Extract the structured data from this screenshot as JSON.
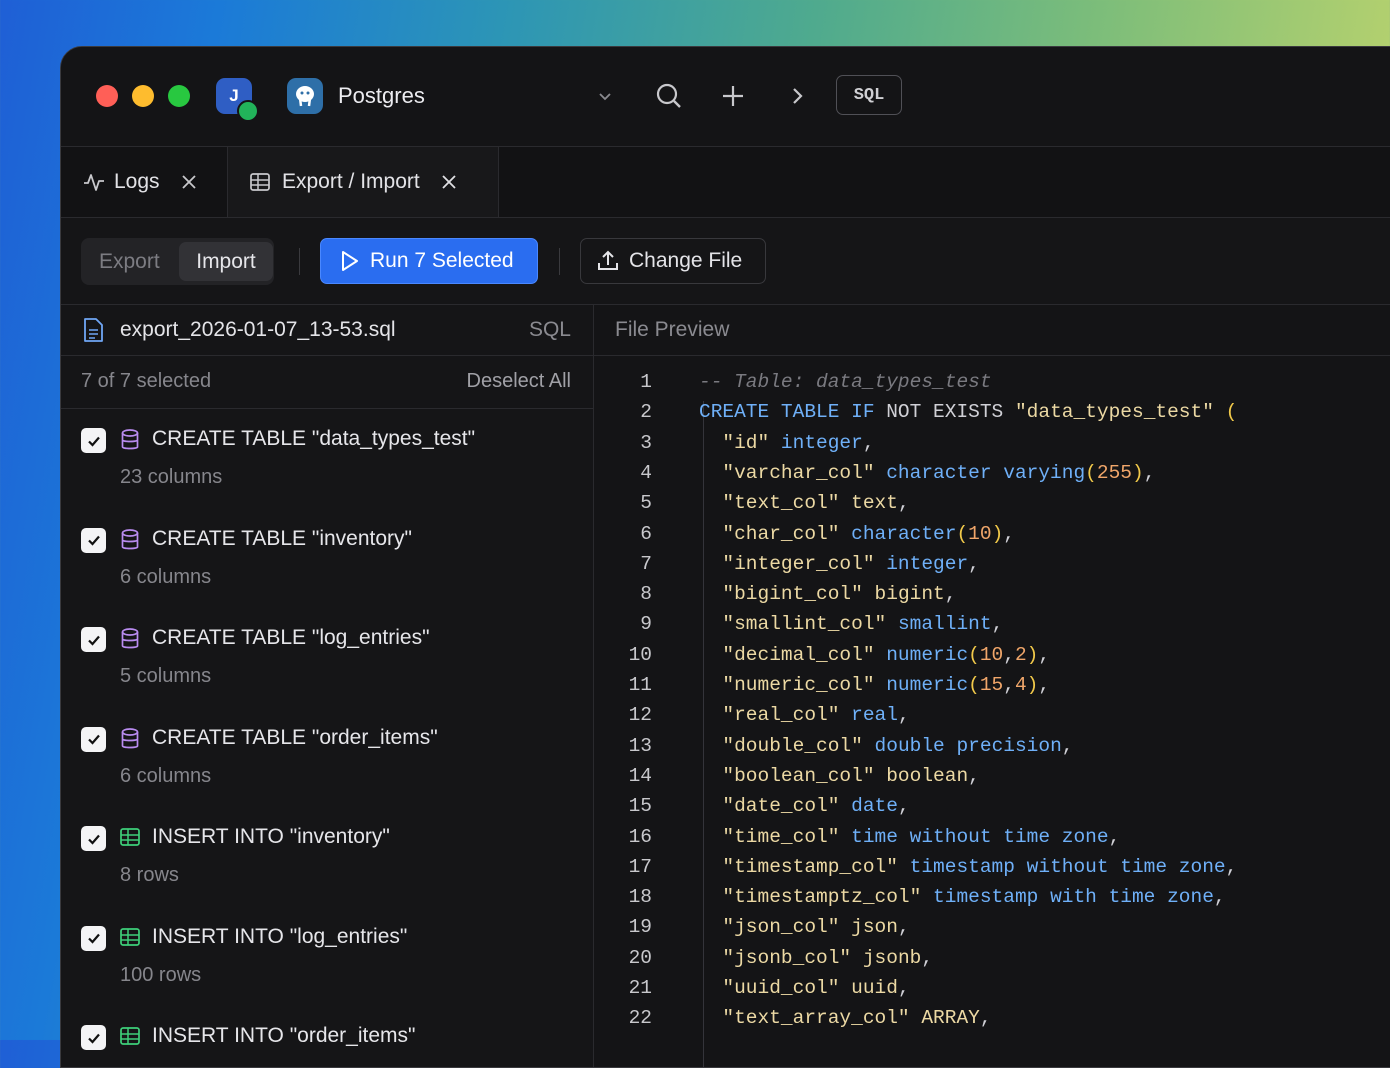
{
  "titlebar": {
    "avatar_initial": "J",
    "db_name": "Postgres",
    "sql_button": "SQL",
    "colors": {
      "close": "#ff5f57",
      "minimize": "#febc2e",
      "zoom": "#28c840"
    }
  },
  "tabs": [
    {
      "label": "Logs",
      "icon": "activity-icon"
    },
    {
      "label": "Export / Import",
      "icon": "table-icon"
    }
  ],
  "toolbar": {
    "mode_export": "Export",
    "mode_import": "Import",
    "run_label": "Run 7 Selected",
    "change_file_label": "Change File"
  },
  "left": {
    "file_name": "export_2026-01-07_13-53.sql",
    "file_type": "SQL",
    "selected_count": "7 of 7 selected",
    "deselect_all": "Deselect All",
    "items": [
      {
        "title": "CREATE TABLE \"data_types_test\"",
        "sub": "23 columns",
        "kind": "table"
      },
      {
        "title": "CREATE TABLE \"inventory\"",
        "sub": "6 columns",
        "kind": "table"
      },
      {
        "title": "CREATE TABLE \"log_entries\"",
        "sub": "5 columns",
        "kind": "table"
      },
      {
        "title": "CREATE TABLE \"order_items\"",
        "sub": "6 columns",
        "kind": "table"
      },
      {
        "title": "INSERT INTO \"inventory\"",
        "sub": "8 rows",
        "kind": "insert"
      },
      {
        "title": "INSERT INTO \"log_entries\"",
        "sub": "100 rows",
        "kind": "insert"
      },
      {
        "title": "INSERT INTO \"order_items\"",
        "sub": "",
        "kind": "insert"
      }
    ]
  },
  "preview": {
    "title": "File Preview",
    "lines": [
      [
        [
          "cm",
          "-- Table: data_types_test"
        ]
      ],
      [
        [
          "kw",
          "CREATE TABLE IF "
        ],
        [
          "pl",
          "NOT EXISTS "
        ],
        [
          "str",
          "\"data_types_test\""
        ],
        [
          "pl",
          " "
        ],
        [
          "pn",
          "("
        ]
      ],
      [
        [
          "pl",
          "  "
        ],
        [
          "str",
          "\"id\""
        ],
        [
          "pl",
          " "
        ],
        [
          "ty",
          "integer"
        ],
        [
          "pl",
          ","
        ]
      ],
      [
        [
          "pl",
          "  "
        ],
        [
          "str",
          "\"varchar_col\""
        ],
        [
          "pl",
          " "
        ],
        [
          "ty",
          "character varying"
        ],
        [
          "pn",
          "("
        ],
        [
          "num",
          "255"
        ],
        [
          "pn",
          ")"
        ],
        [
          "pl",
          ","
        ]
      ],
      [
        [
          "pl",
          "  "
        ],
        [
          "str",
          "\"text_col\""
        ],
        [
          "pl",
          " "
        ],
        [
          "str",
          "text"
        ],
        [
          "pl",
          ","
        ]
      ],
      [
        [
          "pl",
          "  "
        ],
        [
          "str",
          "\"char_col\""
        ],
        [
          "pl",
          " "
        ],
        [
          "ty",
          "character"
        ],
        [
          "pn",
          "("
        ],
        [
          "num",
          "10"
        ],
        [
          "pn",
          ")"
        ],
        [
          "pl",
          ","
        ]
      ],
      [
        [
          "pl",
          "  "
        ],
        [
          "str",
          "\"integer_col\""
        ],
        [
          "pl",
          " "
        ],
        [
          "ty",
          "integer"
        ],
        [
          "pl",
          ","
        ]
      ],
      [
        [
          "pl",
          "  "
        ],
        [
          "str",
          "\"bigint_col\""
        ],
        [
          "pl",
          " "
        ],
        [
          "str",
          "bigint"
        ],
        [
          "pl",
          ","
        ]
      ],
      [
        [
          "pl",
          "  "
        ],
        [
          "str",
          "\"smallint_col\""
        ],
        [
          "pl",
          " "
        ],
        [
          "ty",
          "smallint"
        ],
        [
          "pl",
          ","
        ]
      ],
      [
        [
          "pl",
          "  "
        ],
        [
          "str",
          "\"decimal_col\""
        ],
        [
          "pl",
          " "
        ],
        [
          "ty",
          "numeric"
        ],
        [
          "pn",
          "("
        ],
        [
          "num",
          "10"
        ],
        [
          "pl",
          ","
        ],
        [
          "num",
          "2"
        ],
        [
          "pn",
          ")"
        ],
        [
          "pl",
          ","
        ]
      ],
      [
        [
          "pl",
          "  "
        ],
        [
          "str",
          "\"numeric_col\""
        ],
        [
          "pl",
          " "
        ],
        [
          "ty",
          "numeric"
        ],
        [
          "pn",
          "("
        ],
        [
          "num",
          "15"
        ],
        [
          "pl",
          ","
        ],
        [
          "num",
          "4"
        ],
        [
          "pn",
          ")"
        ],
        [
          "pl",
          ","
        ]
      ],
      [
        [
          "pl",
          "  "
        ],
        [
          "str",
          "\"real_col\""
        ],
        [
          "pl",
          " "
        ],
        [
          "ty",
          "real"
        ],
        [
          "pl",
          ","
        ]
      ],
      [
        [
          "pl",
          "  "
        ],
        [
          "str",
          "\"double_col\""
        ],
        [
          "pl",
          " "
        ],
        [
          "ty",
          "double precision"
        ],
        [
          "pl",
          ","
        ]
      ],
      [
        [
          "pl",
          "  "
        ],
        [
          "str",
          "\"boolean_col\""
        ],
        [
          "pl",
          " "
        ],
        [
          "str",
          "boolean"
        ],
        [
          "pl",
          ","
        ]
      ],
      [
        [
          "pl",
          "  "
        ],
        [
          "str",
          "\"date_col\""
        ],
        [
          "pl",
          " "
        ],
        [
          "ty",
          "date"
        ],
        [
          "pl",
          ","
        ]
      ],
      [
        [
          "pl",
          "  "
        ],
        [
          "str",
          "\"time_col\""
        ],
        [
          "pl",
          " "
        ],
        [
          "ty",
          "time without time zone"
        ],
        [
          "pl",
          ","
        ]
      ],
      [
        [
          "pl",
          "  "
        ],
        [
          "str",
          "\"timestamp_col\""
        ],
        [
          "pl",
          " "
        ],
        [
          "ty",
          "timestamp without time zone"
        ],
        [
          "pl",
          ","
        ]
      ],
      [
        [
          "pl",
          "  "
        ],
        [
          "str",
          "\"timestamptz_col\""
        ],
        [
          "pl",
          " "
        ],
        [
          "ty",
          "timestamp with time zone"
        ],
        [
          "pl",
          ","
        ]
      ],
      [
        [
          "pl",
          "  "
        ],
        [
          "str",
          "\"json_col\""
        ],
        [
          "pl",
          " "
        ],
        [
          "str",
          "json"
        ],
        [
          "pl",
          ","
        ]
      ],
      [
        [
          "pl",
          "  "
        ],
        [
          "str",
          "\"jsonb_col\""
        ],
        [
          "pl",
          " "
        ],
        [
          "str",
          "jsonb"
        ],
        [
          "pl",
          ","
        ]
      ],
      [
        [
          "pl",
          "  "
        ],
        [
          "str",
          "\"uuid_col\""
        ],
        [
          "pl",
          " "
        ],
        [
          "str",
          "uuid"
        ],
        [
          "pl",
          ","
        ]
      ],
      [
        [
          "pl",
          "  "
        ],
        [
          "str",
          "\"text_array_col\""
        ],
        [
          "pl",
          " "
        ],
        [
          "str",
          "ARRAY"
        ],
        [
          "pl",
          ","
        ]
      ]
    ]
  }
}
